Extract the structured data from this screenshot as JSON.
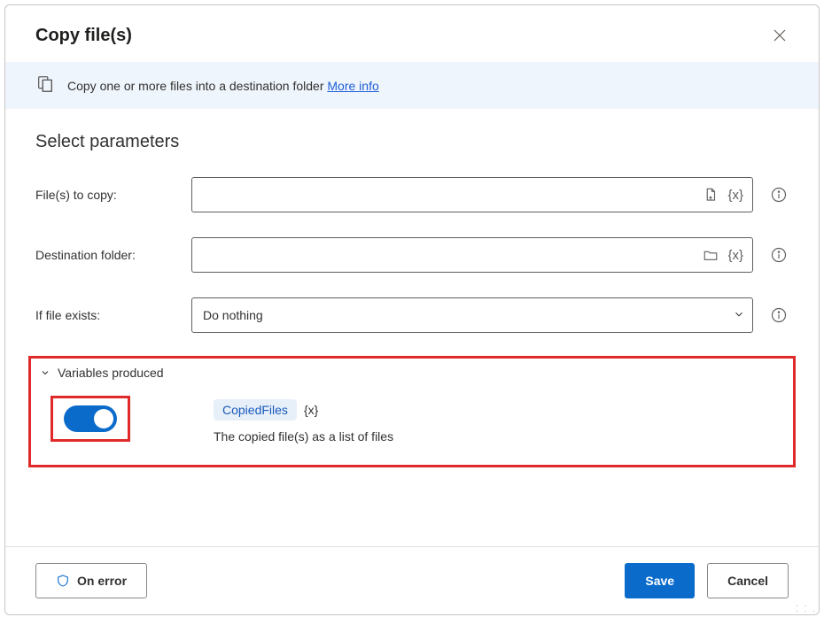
{
  "header": {
    "title": "Copy file(s)"
  },
  "banner": {
    "text": "Copy one or more files into a destination folder ",
    "link": "More info"
  },
  "section": {
    "heading": "Select parameters"
  },
  "fields": {
    "files_label": "File(s) to copy:",
    "files_value": "",
    "dest_label": "Destination folder:",
    "dest_value": "",
    "exists_label": "If file exists:",
    "exists_value": "Do nothing"
  },
  "variables": {
    "header": "Variables produced",
    "name": "CopiedFiles",
    "brace": "{x}",
    "desc": "The copied file(s) as a list of files"
  },
  "footer": {
    "on_error": "On error",
    "save": "Save",
    "cancel": "Cancel"
  }
}
